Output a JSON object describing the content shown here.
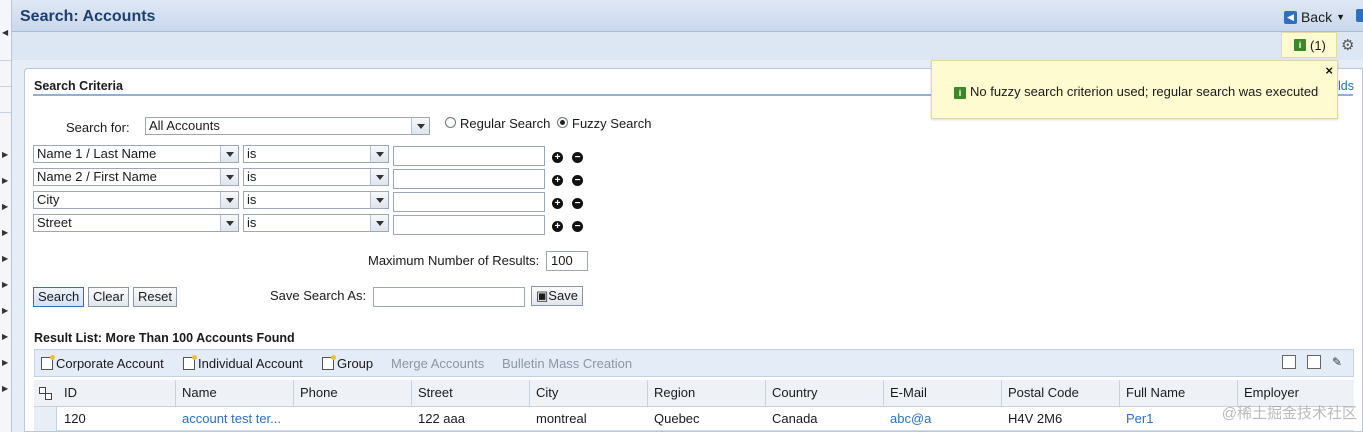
{
  "header": {
    "title": "Search: Accounts",
    "back_label": "Back"
  },
  "messages": {
    "count_label": "(1)",
    "toast_text": "No fuzzy search criterion used; regular search was executed",
    "close_label": "×",
    "info_glyph": "i"
  },
  "criteria": {
    "section_title": "Search Criteria",
    "side_link": "lds",
    "search_for_label": "Search for:",
    "search_for_value": "All Accounts",
    "regular_search_label": "Regular Search",
    "fuzzy_search_label": "Fuzzy Search",
    "rows": [
      {
        "field": "Name 1 / Last Name",
        "operator": "is",
        "value": ""
      },
      {
        "field": "Name 2 / First Name",
        "operator": "is",
        "value": ""
      },
      {
        "field": "City",
        "operator": "is",
        "value": ""
      },
      {
        "field": "Street",
        "operator": "is",
        "value": ""
      }
    ],
    "plus_glyph": "+",
    "minus_glyph": "−",
    "max_results_label": "Maximum Number of Results:",
    "max_results_value": "100",
    "search_button": "Search",
    "clear_button": "Clear",
    "reset_button": "Reset",
    "save_search_label": "Save Search As:",
    "save_search_value": "",
    "save_button": "Save"
  },
  "results": {
    "title": "Result List: More Than 100 Accounts Found",
    "toolbar": {
      "corporate": "Corporate Account",
      "individual": "Individual Account",
      "group": "Group",
      "merge": "Merge Accounts",
      "bulletin": "Bulletin Mass Creation"
    },
    "columns": [
      "ID",
      "Name",
      "Phone",
      "Street",
      "City",
      "Region",
      "Country",
      "E-Mail",
      "Postal Code",
      "Full Name",
      "Employer"
    ],
    "rows": [
      {
        "id": "120",
        "name": "account test ter...",
        "phone": "",
        "street": "122 aaa",
        "city": "montreal",
        "region": "Quebec",
        "country": "Canada",
        "email": "abc@a",
        "postal": "H4V 2M6",
        "full_name": "Per1",
        "employer": ""
      }
    ]
  },
  "watermark": "@稀土掘金技术社区",
  "colors": {
    "accent": "#2e6fbf",
    "toast_bg": "#fffbd0",
    "header_bg": "#c9d8ec"
  }
}
